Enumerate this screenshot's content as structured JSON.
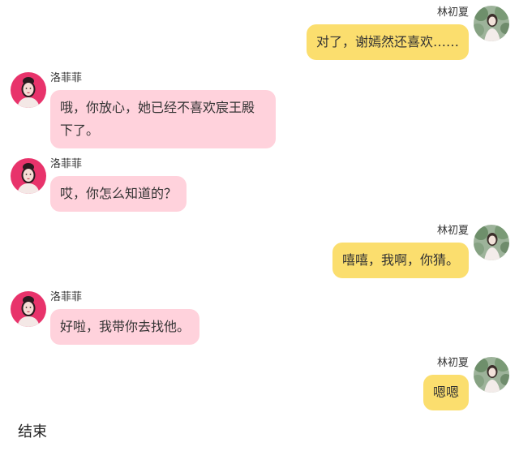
{
  "participants": {
    "left": {
      "name": "洛菲菲",
      "avatar_icon": "pink-background-girl-avatar",
      "bubble_color": "#ffd2dc"
    },
    "right": {
      "name": "林初夏",
      "avatar_icon": "green-garden-girl-avatar",
      "bubble_color": "#fbde6e"
    }
  },
  "messages": [
    {
      "side": "right",
      "sender": "林初夏",
      "text": "对了，谢嫣然还喜欢……"
    },
    {
      "side": "left",
      "sender": "洛菲菲",
      "text": "哦，你放心，她已经不喜欢宸王殿下了。"
    },
    {
      "side": "left",
      "sender": "洛菲菲",
      "text": "哎，你怎么知道的？"
    },
    {
      "side": "right",
      "sender": "林初夏",
      "text": "嘻嘻，我啊，你猜。"
    },
    {
      "side": "left",
      "sender": "洛菲菲",
      "text": "好啦，我带你去找他。"
    },
    {
      "side": "right",
      "sender": "林初夏",
      "text": "嗯嗯"
    }
  ],
  "footer": {
    "text": "结束"
  }
}
